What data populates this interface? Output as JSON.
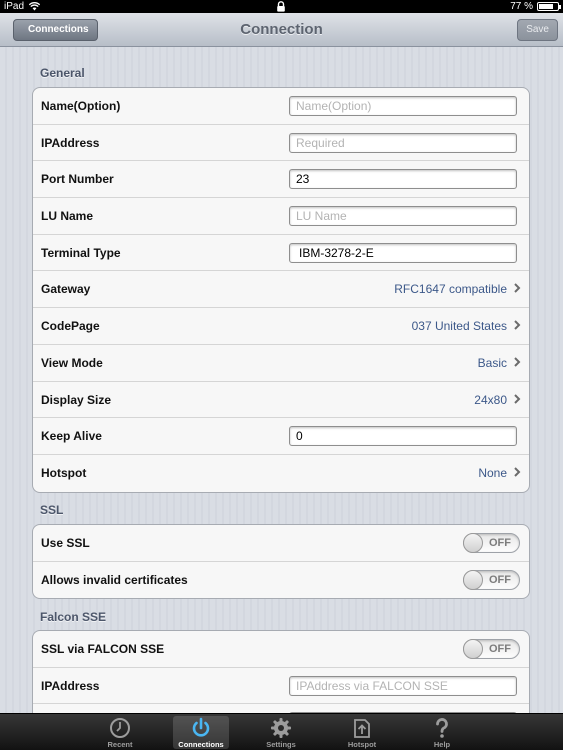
{
  "status": {
    "device": "iPad",
    "battery": "77 %",
    "battery_level": 0.77
  },
  "nav": {
    "back_label": "Connections",
    "title": "Connection",
    "save_label": "Save"
  },
  "general": {
    "title": "General",
    "name_label": "Name(Option)",
    "name_placeholder": "Name(Option)",
    "name_value": "",
    "ip_label": "IPAddress",
    "ip_placeholder": "Required",
    "ip_value": "",
    "port_label": "Port Number",
    "port_value": "23",
    "lu_label": "LU Name",
    "lu_placeholder": "LU Name",
    "lu_value": "",
    "terminal_label": "Terminal Type",
    "terminal_value": "IBM-3278-2-E",
    "gateway_label": "Gateway",
    "gateway_value": "RFC1647 compatible",
    "codepage_label": "CodePage",
    "codepage_value": "037 United States",
    "viewmode_label": "View Mode",
    "viewmode_value": "Basic",
    "displaysize_label": "Display Size",
    "displaysize_value": "24x80",
    "keepalive_label": "Keep Alive",
    "keepalive_value": "0",
    "hotspot_label": "Hotspot",
    "hotspot_value": "None"
  },
  "ssl": {
    "title": "SSL",
    "use_ssl_label": "Use SSL",
    "use_ssl_state": "OFF",
    "invalid_cert_label": "Allows invalid certificates",
    "invalid_cert_state": "OFF"
  },
  "falcon": {
    "title": "Falcon SSE",
    "ssl_falcon_label": "SSL via FALCON SSE",
    "ssl_falcon_state": "OFF",
    "ip_label": "IPAddress",
    "ip_placeholder": "IPAddress via FALCON SSE",
    "ip_value": ""
  },
  "tabs": [
    {
      "label": "Recent",
      "icon": "clock-icon"
    },
    {
      "label": "Connections",
      "icon": "power-icon"
    },
    {
      "label": "Settings",
      "icon": "gear-icon"
    },
    {
      "label": "Hotspot",
      "icon": "hotspot-icon"
    },
    {
      "label": "Help",
      "icon": "question-icon"
    }
  ],
  "colors": {
    "value_blue": "#3c5889",
    "section_title": "#4c566a"
  }
}
